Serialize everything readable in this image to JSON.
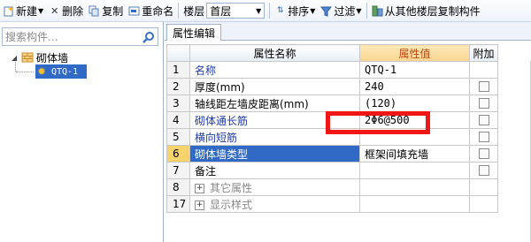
{
  "toolbar": {
    "new_label": "新建",
    "delete_label": "删除",
    "copy_label": "复制",
    "rename_label": "重命名",
    "floor_label": "楼层",
    "floor_value": "首层",
    "sort_label": "排序",
    "filter_label": "过滤",
    "copy_from_floor_label": "从其他楼层复制构件"
  },
  "search": {
    "placeholder": "搜索构件..."
  },
  "tree": {
    "root_label": "砌体墙",
    "child_label": "QTQ-1"
  },
  "panel": {
    "tab_label": "属性编辑"
  },
  "grid": {
    "headers": {
      "num": "",
      "name": "属性名称",
      "value": "属性值",
      "extra": "附加"
    },
    "rows": [
      {
        "num": "1",
        "name": "名称",
        "value": "QTQ-1",
        "checkbox": false
      },
      {
        "num": "2",
        "name": "厚度(mm)",
        "value": "240",
        "checkbox": true
      },
      {
        "num": "3",
        "name": "轴线距左墙皮距离(mm)",
        "value": "(120)",
        "checkbox": true
      },
      {
        "num": "4",
        "name": "砌体通长筋",
        "value": "2Φ6@500",
        "checkbox": true
      },
      {
        "num": "5",
        "name": "横向短筋",
        "value": "",
        "checkbox": true
      },
      {
        "num": "6",
        "name": "砌体墙类型",
        "value": "框架间填充墙",
        "checkbox": true
      },
      {
        "num": "7",
        "name": "备注",
        "value": "",
        "checkbox": true
      },
      {
        "num": "8",
        "name": "其它属性",
        "value": "",
        "checkbox": false
      },
      {
        "num": "17",
        "name": "显示样式",
        "value": "",
        "checkbox": false
      }
    ]
  },
  "colors": {
    "selection": "#3169c6",
    "annotation": "#f21616",
    "header_highlight": "#c2440e"
  }
}
